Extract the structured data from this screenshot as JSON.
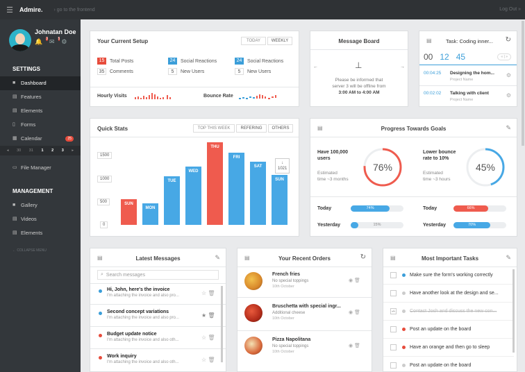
{
  "topbar": {
    "brand": "Admire.",
    "frontend": "› go to the frontend",
    "logout": "Log Out »"
  },
  "profile": {
    "name": "Johnatan Doe",
    "notif_count": "3",
    "mail_count": "5"
  },
  "sidebar": {
    "settings_label": "SETTINGS",
    "settings_items": [
      {
        "label": "Dashboard"
      },
      {
        "label": "Features"
      },
      {
        "label": "Elements"
      },
      {
        "label": "Forms"
      },
      {
        "label": "Calendar",
        "badge": "25"
      }
    ],
    "calendar_strip": [
      "◂",
      "30",
      "31",
      "1",
      "2",
      "3",
      "▸"
    ],
    "file_manager": "File Manager",
    "management_label": "MANAGEMENT",
    "management_items": [
      {
        "label": "Gallery"
      },
      {
        "label": "Videos"
      },
      {
        "label": "Elements"
      }
    ],
    "collapse": "← COLLAPSE MENU"
  },
  "setup": {
    "title": "Your Current Setup",
    "tab_today": "TODAY",
    "tab_weekly": "WEEKLY",
    "stats": [
      {
        "num": "15",
        "label": "Total Posts",
        "color": "red"
      },
      {
        "num": "24",
        "label": "Social Reactions",
        "color": "blue"
      },
      {
        "num": "24",
        "label": "Social Reactions",
        "color": "blue"
      },
      {
        "num": "35",
        "label": "Comments",
        "color": "grey"
      },
      {
        "num": "5",
        "label": "New Users",
        "color": "grey"
      },
      {
        "num": "5",
        "label": "New Users",
        "color": "grey"
      }
    ],
    "hourly_visits": "Hourly Visits",
    "bounce_rate": "Bounce Rate"
  },
  "message_board": {
    "title": "Message Board",
    "text1": "Please be informed that",
    "text2": "server 3 will be offline from",
    "text3": "3:00 AM to 4:00 AM"
  },
  "task_card": {
    "title": "Task: Coding inner...",
    "timer": [
      "00",
      "12",
      "45"
    ],
    "items": [
      {
        "time": "00:04:25",
        "name": "Designing the hom...",
        "sub": "Project Name"
      },
      {
        "time": "00:02:02",
        "name": "Talking with client",
        "sub": "Project Name"
      }
    ]
  },
  "quick_stats": {
    "title": "Quick Stats",
    "tabs": [
      "TOP THIS WEEK",
      "REFERING",
      "OTHERS"
    ],
    "yticks": [
      "1500",
      "1000",
      "500",
      "0"
    ],
    "tooltip_val": "1021"
  },
  "chart_data": {
    "type": "bar",
    "categories": [
      "SUN",
      "MON",
      "TUE",
      "WED",
      "THU",
      "FRI",
      "SAT",
      "SUN"
    ],
    "values": [
      490,
      410,
      940,
      1130,
      1590,
      1400,
      1220,
      970
    ],
    "ylim": [
      0,
      1650
    ],
    "colors": [
      "#ef5b4e",
      "#47a8e5",
      "#47a8e5",
      "#47a8e5",
      "#ef5b4e",
      "#47a8e5",
      "#47a8e5",
      "#47a8e5"
    ]
  },
  "progress": {
    "title": "Progress Towards Goals",
    "goal1": {
      "title1": "Have 100,000",
      "title2": "users",
      "est1": "Estimated",
      "est2": "time ~3 months",
      "pct": "76%",
      "value": 0.76,
      "color": "#ef5b4e"
    },
    "goal2": {
      "title1": "Lower bounce",
      "title2": "rate to 10%",
      "est1": "Estimated",
      "est2": "time ~3 hours",
      "pct": "45%",
      "value": 0.45,
      "color": "#47a8e5"
    },
    "bars": [
      {
        "label": "Today",
        "pct": "74%",
        "value": 0.74,
        "color": "#47a8e5"
      },
      {
        "label": "Today",
        "pct": "66%",
        "value": 0.66,
        "color": "#ef5b4e"
      },
      {
        "label": "Yesterday",
        "pct": "15%",
        "value": 0.15,
        "color": "#47a8e5"
      },
      {
        "label": "Yesterday",
        "pct": "70%",
        "value": 0.7,
        "color": "#47a8e5"
      }
    ]
  },
  "messages": {
    "title": "Latest Messages",
    "search_placeholder": "Search messages",
    "items": [
      {
        "title": "Hi, John, here's the invoice",
        "sub": "I'm attaching the invoice and also pro...",
        "color": "#3b9ed9"
      },
      {
        "title": "Second concept variations",
        "sub": "I'm attaching the invoice and also pro...",
        "color": "#3b9ed9"
      },
      {
        "title": "Budget update notice",
        "sub": "I'm attaching the invoice and also oth...",
        "color": "#e74c3c"
      },
      {
        "title": "Work inquiry",
        "sub": "I'm attaching the invoice and also oth...",
        "color": "#e74c3c"
      }
    ]
  },
  "orders": {
    "title": "Your Recent Orders",
    "items": [
      {
        "name": "French fries",
        "sub": "No special toppings",
        "date": "10th October"
      },
      {
        "name": "Bruschetta with special ingr...",
        "sub": "Additional cheese",
        "date": "10th October"
      },
      {
        "name": "Pizza Napolitana",
        "sub": "No special toppings",
        "date": "10th October"
      }
    ]
  },
  "tasks": {
    "title": "Most Important Tasks",
    "items": [
      {
        "text": "Make sure the form's working correctly",
        "color": "#3b9ed9",
        "done": false
      },
      {
        "text": "Have another look at the design and se...",
        "color": "#ccc",
        "done": false
      },
      {
        "text": "Contact Josh and discuss the new con...",
        "color": "#ccc",
        "done": true
      },
      {
        "text": "Post an update on the board",
        "color": "#e74c3c",
        "done": false
      },
      {
        "text": "Have an orange and then go to sleep",
        "color": "#e74c3c",
        "done": false
      },
      {
        "text": "Post an update on the board",
        "color": "#ccc",
        "done": false
      }
    ]
  }
}
